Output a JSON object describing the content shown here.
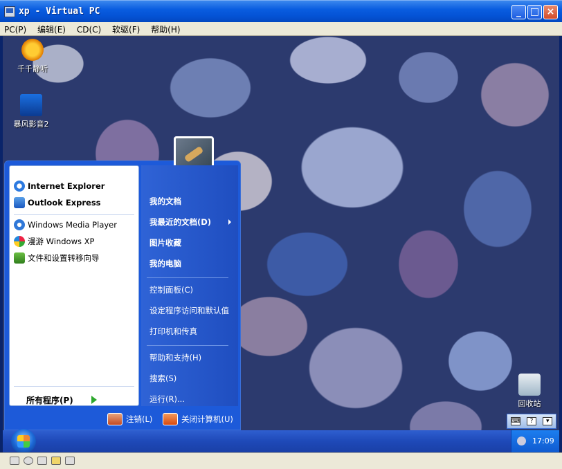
{
  "window": {
    "title": "xp - Virtual PC",
    "minimize": "_",
    "maximize": "□",
    "close": "×"
  },
  "menubar": [
    "PC(P)",
    "编辑(E)",
    "CD(C)",
    "软驱(F)",
    "帮助(H)"
  ],
  "desktop_icons": [
    {
      "label": "千千静听",
      "icon": "ttpod-icon"
    },
    {
      "label": "暴风影音2",
      "icon": "storm-player-icon"
    },
    {
      "label": "回收站",
      "icon": "recycle-bin-icon"
    }
  ],
  "start_menu": {
    "pinned": [
      "Internet Explorer",
      "Outlook Express"
    ],
    "recent": [
      "Windows Media Player",
      "漫游 Windows XP",
      "文件和设置转移向导"
    ],
    "all_programs": "所有程序(P)",
    "places_bold": [
      "我的文档",
      "我最近的文档(D)",
      "图片收藏",
      "我的电脑"
    ],
    "places_settings": [
      "控制面板(C)",
      "设定程序访问和默认值",
      "打印机和传真"
    ],
    "places_help": [
      "帮助和支持(H)",
      "搜索(S)",
      "运行(R)..."
    ],
    "logoff": "注销(L)",
    "shutdown": "关闭计算机(U)"
  },
  "taskbar": {
    "clock": "17:09"
  },
  "langbar": [
    "⌨",
    "?",
    "▾"
  ]
}
